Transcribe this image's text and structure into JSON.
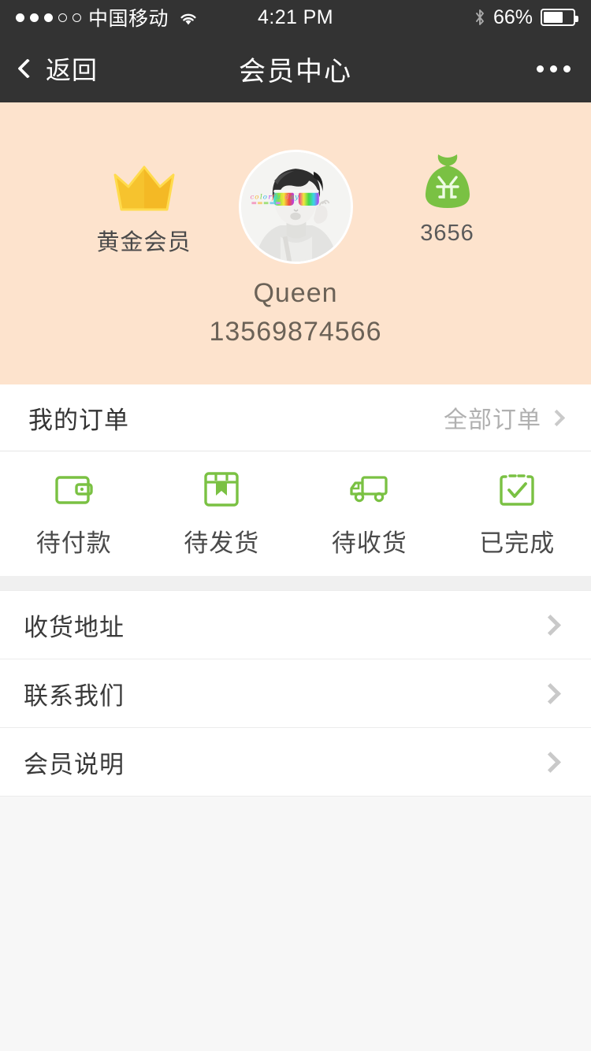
{
  "status_bar": {
    "signal_dots_filled": 3,
    "signal_dots_total": 5,
    "carrier": "中国移动",
    "wifi_icon": "wifi-icon",
    "time": "4:21 PM",
    "bluetooth_icon": "bluetooth-icon",
    "battery_percent": "66%",
    "battery_level": 66
  },
  "nav_bar": {
    "back_label": "返回",
    "title": "会员中心",
    "more_icon": "more-dots-icon",
    "background": "#333333",
    "text_color": "#ffffff"
  },
  "profile": {
    "background": "#fde3cd",
    "level_icon": "crown-icon",
    "level_label": "黄金会员",
    "avatar_icon": "user-avatar",
    "points_icon": "money-bag-icon",
    "points_value": "3656",
    "name": "Queen",
    "phone": "13569874566",
    "crown_color": "#f9c939",
    "points_color": "#7ac143"
  },
  "orders": {
    "title": "我的订单",
    "all_orders_label": "全部订单",
    "chevron_icon": "chevron-right-icon",
    "items": [
      {
        "icon": "wallet-icon",
        "label": "待付款"
      },
      {
        "icon": "package-icon",
        "label": "待发货"
      },
      {
        "icon": "truck-icon",
        "label": "待收货"
      },
      {
        "icon": "checklist-icon",
        "label": "已完成"
      }
    ],
    "icon_color": "#7ac143"
  },
  "menu": {
    "items": [
      {
        "label": "收货地址",
        "chevron": "chevron-right-icon"
      },
      {
        "label": "联系我们",
        "chevron": "chevron-right-icon"
      },
      {
        "label": "会员说明",
        "chevron": "chevron-right-icon"
      }
    ]
  }
}
